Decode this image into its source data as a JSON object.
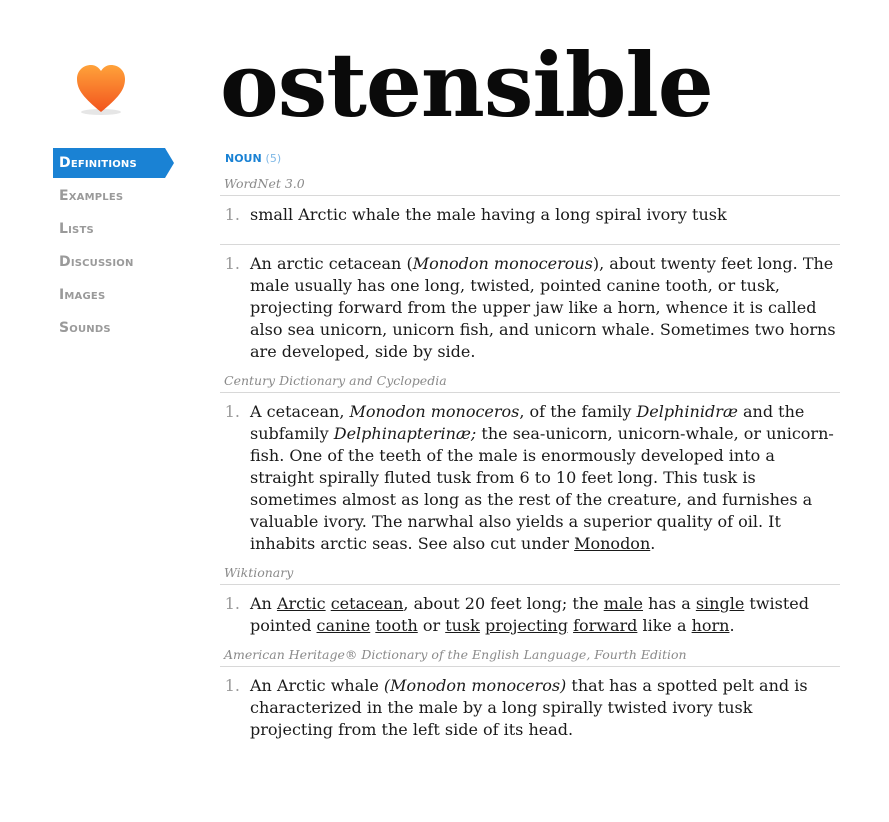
{
  "colors": {
    "accent": "#1a82d4",
    "heart": "#f26522",
    "nav_inactive": "#9a9a9a"
  },
  "logo": {
    "icon": "heart-icon"
  },
  "sidebar": {
    "items": [
      {
        "label": "Definitions",
        "active": true
      },
      {
        "label": "Examples"
      },
      {
        "label": "Lists"
      },
      {
        "label": "Discussion"
      },
      {
        "label": "Images"
      },
      {
        "label": "Sounds"
      }
    ]
  },
  "word": "ostensible",
  "pos": {
    "label": "NOUN",
    "count": "(5)"
  },
  "sources": {
    "wordnet": "WordNet 3.0",
    "century": "Century Dictionary and Cyclopedia",
    "wiktionary": "Wiktionary",
    "ahd": "American Heritage® Dictionary of the English Language, Fourth Edition"
  },
  "defs": {
    "wn1": {
      "num": "1.",
      "text": "small Arctic whale the male having a long spiral ivory tusk"
    },
    "gc1": {
      "num": "1.",
      "t1": "An arctic cetacean (",
      "i1": "Monodon monocerous",
      "t2": "), about twenty feet long. The male usually has one long, twisted, pointed canine tooth, or tusk, projecting forward from the upper jaw like a horn, whence it is called also sea unicorn, unicorn fish, and unicorn whale. Sometimes two horns are developed, side by side."
    },
    "cd1": {
      "num": "1.",
      "t1": "A cetacean, ",
      "i1": "Monodon monoceros",
      "t2": ", of the family ",
      "i2": "Delphinidræ",
      "t3": " and the subfamily ",
      "i3": "Delphinapterinæ;",
      "t4": " the sea-unicorn, unicorn-whale, or unicorn-fish. One of the teeth of the male is enormously developed into a straight spirally fluted tusk from 6 to 10 feet long. This tusk is sometimes almost as long as the rest of the creature, and furnishes a valuable ivory. The narwhal also yields a superior quality of oil. It inhabits arctic seas. See also cut under ",
      "link": "Monodon",
      "t5": "."
    },
    "wk1": {
      "num": "1.",
      "t1": "An ",
      "l1": "Arctic",
      "t2": " ",
      "l2": "cetacean",
      "t3": ", about 20 feet long; the ",
      "l3": "male",
      "t4": " has a ",
      "l4": "single",
      "t5": " twisted pointed ",
      "l5": "canine",
      "t6": " ",
      "l6": "tooth",
      "t7": " or ",
      "l7": "tusk",
      "t8": " ",
      "l8": "projecting",
      "t9": " ",
      "l9": "forward",
      "t10": " like a ",
      "l10": "horn",
      "t11": "."
    },
    "ah1": {
      "num": "1.",
      "t1": "An Arctic whale ",
      "i1": "(Monodon monoceros)",
      "t2": " that has a spotted pelt and is characterized in the male by a long spirally twisted ivory tusk projecting from the left side of its head."
    }
  }
}
